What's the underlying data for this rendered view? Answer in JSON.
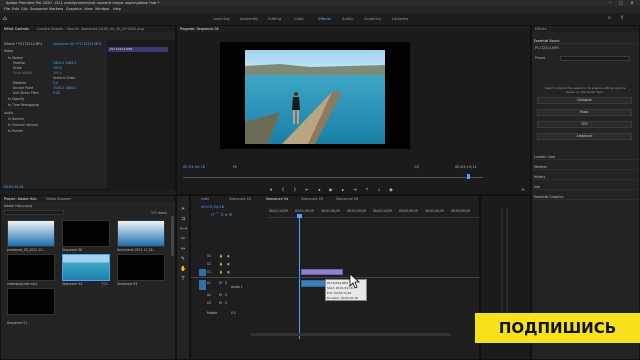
{
  "titlebar": {
    "title": "Adobe Premiere Pro 2020 - D:\\1 uroki\\premier\\kak soxranit mayer zapisi\\Adobe Hub *"
  },
  "menu": [
    "File",
    "Edit",
    "Clip",
    "Sequence",
    "Markers",
    "Graphics",
    "View",
    "Window",
    "Help"
  ],
  "workspaces": [
    "Learning",
    "Assembly",
    "Editing",
    "Color",
    "Effects",
    "Audio",
    "Graphics",
    "Libraries"
  ],
  "workspace_active": "Effects",
  "effect_controls": {
    "tabs": [
      "Effect Controls",
      "Lumetri Scopes",
      "Source: Sequence 03.00_00_10_29 0020.png",
      "Audio Clip Mixer: Sequence 04"
    ],
    "master": "Master * P1172514.MP4",
    "sequence": "Sequence 04 * P1172514.MP4",
    "clip_label": "P1172514.MP4",
    "section_video": "Video",
    "props": [
      {
        "name": "fx Motion",
        "value": ""
      },
      {
        "name": "Position",
        "value": "1920.0   1080.0"
      },
      {
        "name": "Scale",
        "value": "100.0"
      },
      {
        "name": "Scale Width",
        "value": "100.0"
      },
      {
        "name": "",
        "value": "Uniform Scale"
      },
      {
        "name": "Rotation",
        "value": "0.0"
      },
      {
        "name": "Anchor Point",
        "value": "1920.0   1080.0"
      },
      {
        "name": "Anti-flicker Filter",
        "value": "0.00"
      },
      {
        "name": "fx Opacity",
        "value": ""
      },
      {
        "name": "fx Time Remapping",
        "value": ""
      }
    ],
    "section_audio": "Audio",
    "audio_props": [
      "fx Volume",
      "fx Channel Volume",
      "fx Panner"
    ],
    "timecode": "00;03;34;16"
  },
  "program": {
    "title": "Program: Sequence 04",
    "timecode_left": "00;03;34;16",
    "fit": "Fit",
    "ratio": "1/4",
    "timecode_right": "00;03;19;11"
  },
  "project": {
    "tabs": [
      "Project: Adobe Hub",
      "Media Browser"
    ],
    "file": "Adobe Hub.prproj",
    "count": "171 items",
    "items": [
      {
        "name": "prostanse_05_2021-12...",
        "dur": "5;11",
        "thumb": "blue"
      },
      {
        "name": "Sequence 06",
        "dur": "",
        "thumb": "black"
      },
      {
        "name": "fonmicaret 2021 11 28...",
        "dur": "4;01",
        "thumb": "blue"
      },
      {
        "name": "Sequence 05",
        "dur": "5;29",
        "thumb": "blue"
      },
      {
        "name": "videosplayhall.mp4",
        "dur": "",
        "thumb": "black"
      },
      {
        "name": "Sequence 04",
        "dur": "7;11",
        "thumb": "photo"
      },
      {
        "name": "Sequence 03",
        "dur": "2;45",
        "thumb": "black"
      },
      {
        "name": "Sequence 01",
        "dur": "",
        "thumb": "black"
      }
    ]
  },
  "timeline": {
    "tabs": [
      "ketki",
      "Sequence 03",
      "Sequence 04",
      "Sequence 05",
      "Sequence 06"
    ],
    "active_tab": "Sequence 04",
    "timecode": "00;03;34;16",
    "ruler": [
      "00;01;14;29",
      "00;01;29;29",
      "00;01;44;29",
      "00;01;59;29",
      "00;02;14;29",
      "00;02;29;29",
      "00;02;44;29",
      "00;02;59;29"
    ],
    "tracks_video": [
      "V3",
      "V2",
      "V1"
    ],
    "tracks_audio": [
      "A1",
      "A2",
      "A3"
    ],
    "audio_label": "Audio 1",
    "master_label": "Master",
    "master_value": "0.0",
    "tooltip": {
      "line1": "P1172514.MP4",
      "line2": "Start: 00;01;51;16",
      "line3": "End: 00;03;34;16",
      "line4": "Duration: 00;00;07;16"
    }
  },
  "essential_sound": {
    "tab": "Effects",
    "title": "Essential Sound",
    "clip": "P1172514.MP4",
    "preset_label": "Preset",
    "hint": "Select a tag to the selection to enable editing options based on the Audio Type.",
    "buttons": [
      "Dialogue",
      "Music",
      "SFX",
      "Ambience"
    ],
    "rows": [
      "Lumetri Color",
      "Markers",
      "History",
      "Info",
      "Essential Graphics"
    ]
  },
  "subscribe": {
    "label": "ПОДПИШИСЬ",
    "color": "#f5e21b"
  }
}
